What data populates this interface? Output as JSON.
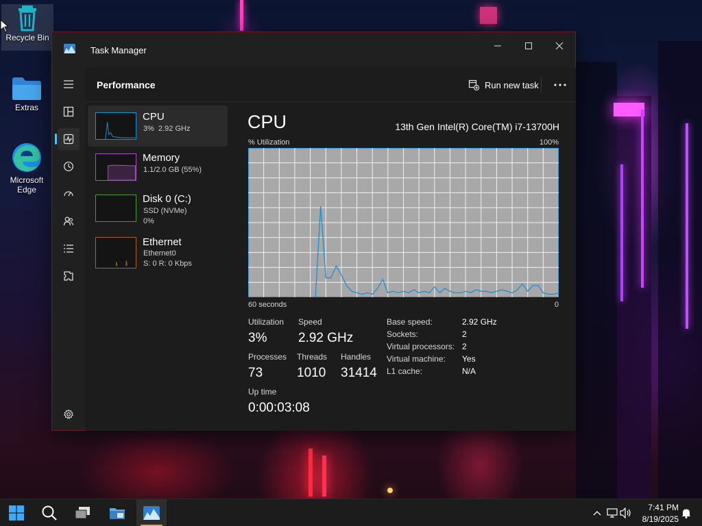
{
  "desktop": {
    "icons": [
      {
        "label": "Recycle Bin",
        "icon": "recycle-bin-icon"
      },
      {
        "label": "Extras",
        "icon": "folder-icon"
      },
      {
        "label": "Microsoft Edge",
        "icon": "edge-icon"
      }
    ]
  },
  "window": {
    "title": "Task Manager",
    "app_icon": "task-manager-icon"
  },
  "nav": {
    "items": [
      {
        "name": "menu",
        "icon": "hamburger-icon"
      },
      {
        "name": "processes",
        "icon": "processes-icon"
      },
      {
        "name": "performance",
        "icon": "performance-icon",
        "active": true
      },
      {
        "name": "app-history",
        "icon": "history-icon"
      },
      {
        "name": "startup-apps",
        "icon": "startup-icon"
      },
      {
        "name": "users",
        "icon": "users-icon"
      },
      {
        "name": "details",
        "icon": "details-icon"
      },
      {
        "name": "services",
        "icon": "services-icon"
      },
      {
        "name": "settings",
        "icon": "gear-icon"
      }
    ]
  },
  "header": {
    "page_title": "Performance",
    "run_new_task": "Run new task"
  },
  "resources": [
    {
      "name": "CPU",
      "line1": "3%  2.92 GHz",
      "line2": "",
      "color": "#1e8fd6",
      "active": true
    },
    {
      "name": "Memory",
      "line1": "1.1/2.0 GB (55%)",
      "line2": "",
      "color": "#a84fbf"
    },
    {
      "name": "Disk 0 (C:)",
      "line1": "SSD (NVMe)",
      "line2": "0%",
      "color": "#4c9a2a"
    },
    {
      "name": "Ethernet",
      "line1": "Ethernet0",
      "line2": "S: 0 R: 0 Kbps",
      "color": "#a8632a"
    }
  ],
  "cpu": {
    "title": "CPU",
    "model": "13th Gen Intel(R) Core(TM) i7-13700H",
    "graph_label": "% Utilization",
    "graph_max": "100%",
    "time_label": "60 seconds",
    "time_end": "0",
    "stats": {
      "utilization_label": "Utilization",
      "utilization": "3%",
      "speed_label": "Speed",
      "speed": "2.92 GHz",
      "processes_label": "Processes",
      "processes": "73",
      "threads_label": "Threads",
      "threads": "1010",
      "handles_label": "Handles",
      "handles": "31414",
      "uptime_label": "Up time",
      "uptime": "0:00:03:08"
    },
    "specs": [
      {
        "key": "Base speed:",
        "value": "2.92 GHz"
      },
      {
        "key": "Sockets:",
        "value": "2"
      },
      {
        "key": "Virtual processors:",
        "value": "2"
      },
      {
        "key": "Virtual machine:",
        "value": "Yes"
      },
      {
        "key": "L1 cache:",
        "value": "N/A"
      }
    ]
  },
  "chart_data": {
    "type": "line",
    "x": [
      60,
      58,
      56,
      54,
      52,
      50,
      48,
      47,
      46,
      45,
      44,
      43,
      42,
      41,
      40,
      39,
      38,
      37,
      36,
      35,
      34,
      33,
      32,
      31,
      30,
      29,
      28,
      27,
      26,
      25,
      24,
      23,
      22,
      21,
      20,
      19,
      18,
      17,
      16,
      15,
      14,
      13,
      12,
      11,
      10,
      9,
      8,
      7,
      6,
      5,
      4,
      3,
      2,
      1,
      0
    ],
    "values": [
      null,
      null,
      null,
      null,
      null,
      null,
      null,
      0,
      61,
      13,
      13,
      21,
      15,
      8,
      4,
      3,
      2,
      3,
      2,
      6,
      12,
      3,
      4,
      3,
      4,
      3,
      5,
      3,
      4,
      3,
      7,
      3,
      6,
      4,
      3,
      3,
      4,
      3,
      5,
      4,
      4,
      3,
      4,
      5,
      4,
      3,
      5,
      9,
      4,
      8,
      8,
      3,
      2,
      2,
      3
    ],
    "ylim": [
      0,
      100
    ],
    "xlim": [
      60,
      0
    ],
    "grid": true,
    "series_color": "#1a8fd6",
    "background": "#a8a8a8"
  },
  "taskbar": {
    "buttons": [
      {
        "name": "start",
        "icon": "windows-start-icon"
      },
      {
        "name": "search",
        "icon": "search-icon"
      },
      {
        "name": "task-view",
        "icon": "task-view-icon"
      },
      {
        "name": "file-explorer",
        "icon": "file-explorer-icon"
      },
      {
        "name": "task-manager",
        "icon": "task-manager-icon",
        "active": true
      }
    ],
    "tray": {
      "time": "7:41 PM",
      "date": "8/19/2025"
    }
  }
}
